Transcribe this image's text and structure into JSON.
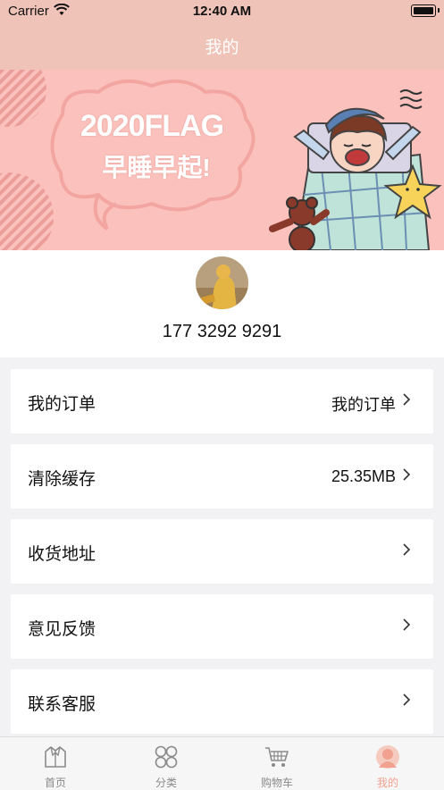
{
  "status_bar": {
    "carrier": "Carrier",
    "time": "12:40 AM"
  },
  "nav": {
    "title": "我的"
  },
  "banner": {
    "line1": "2020FLAG",
    "line2": "早睡早起!"
  },
  "profile": {
    "phone": "177 3292 9291"
  },
  "menu": [
    {
      "label": "我的订单",
      "value": "我的订单"
    },
    {
      "label": "清除缓存",
      "value": "25.35MB"
    },
    {
      "label": "收货地址",
      "value": ""
    },
    {
      "label": "意见反馈",
      "value": ""
    },
    {
      "label": "联系客服",
      "value": ""
    }
  ],
  "tabs": [
    {
      "label": "首页",
      "icon": "home-jacket-icon",
      "active": false
    },
    {
      "label": "分类",
      "icon": "category-grid-icon",
      "active": false
    },
    {
      "label": "购物车",
      "icon": "cart-icon",
      "active": false
    },
    {
      "label": "我的",
      "icon": "profile-icon",
      "active": true
    }
  ],
  "colors": {
    "accent": "#f0a190",
    "header": "#f0c3b8",
    "banner": "#fbc2bd"
  }
}
